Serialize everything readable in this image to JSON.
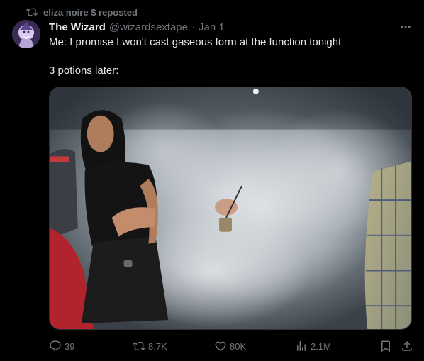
{
  "repost": {
    "text": "eliza noire $ reposted"
  },
  "tweet": {
    "display_name": "The Wizard",
    "handle": "@wizardsextape",
    "separator": "·",
    "date": "Jan 1",
    "line1": "Me: I promise I won't cast gaseous form at the function tonight",
    "line2": "3 potions later:"
  },
  "media": {
    "icon": "photo"
  },
  "actions": {
    "replies": "39",
    "reposts": "8.7K",
    "likes": "80K",
    "views": "2.1M"
  },
  "icons": {
    "repost_indicator": "repost-icon",
    "more": "more-dots-icon",
    "reply": "reply-icon",
    "repost": "repost-icon",
    "like": "heart-icon",
    "views": "views-icon",
    "bookmark": "bookmark-icon",
    "share": "share-icon"
  },
  "colors": {
    "background": "#000000",
    "text": "#e7e9ea",
    "muted": "#71767b",
    "border": "#2f3336"
  }
}
